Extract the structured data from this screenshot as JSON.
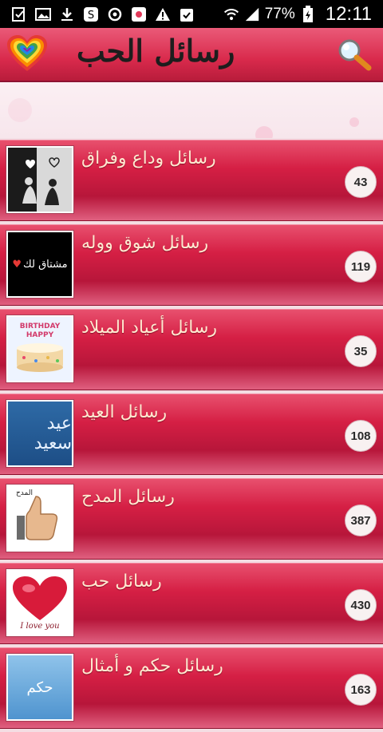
{
  "status_bar": {
    "battery": "77%",
    "time": "12:11",
    "left_icons": [
      "download-check-icon",
      "image-icon",
      "download-icon",
      "s-app-icon",
      "sync-icon",
      "photo-app-icon",
      "warning-icon",
      "clipboard-icon"
    ],
    "right_icons": [
      "wifi-icon",
      "signal-icon",
      "battery-charging-icon"
    ]
  },
  "app_bar": {
    "title": "رسائل الحب",
    "logo_icon": "rainbow-heart-icon",
    "search_icon": "search-icon"
  },
  "categories": [
    {
      "title": "رسائل وداع وفراق",
      "count": "43",
      "thumb": "sad-couple-image"
    },
    {
      "title": "رسائل شوق ووله",
      "count": "119",
      "thumb": "mishtaq-lak-image",
      "thumb_text": "مشتاق لك"
    },
    {
      "title": "رسائل أعياد الميلاد",
      "count": "35",
      "thumb": "birthday-cake-image",
      "thumb_text": "BIRTHDAY HAPPY"
    },
    {
      "title": "رسائل العيد",
      "count": "108",
      "thumb": "eid-saeed-image",
      "thumb_text": "عيد سعيد"
    },
    {
      "title": "رسائل المدح",
      "count": "387",
      "thumb": "thumbs-up-image",
      "thumb_text": "المدح"
    },
    {
      "title": "رسائل حب",
      "count": "430",
      "thumb": "love-heart-image",
      "thumb_text": "I love you"
    },
    {
      "title": "رسائل حكم و أمثال",
      "count": "163",
      "thumb": "wisdom-image",
      "thumb_text": "حكم"
    }
  ]
}
